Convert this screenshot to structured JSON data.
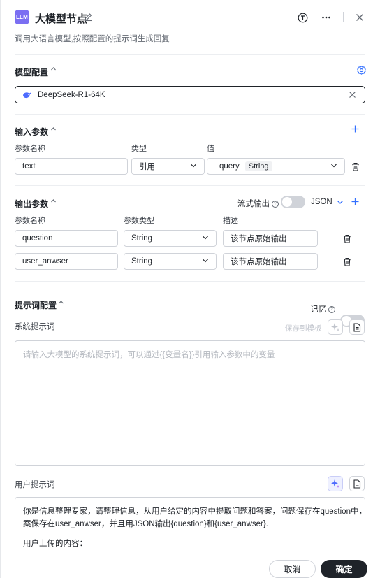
{
  "header": {
    "logo_text": "LLM",
    "title": "大模型节点",
    "subtitle": "调用大语言模型,按照配置的提示词生成回复"
  },
  "model_section": {
    "title": "模型配置",
    "model_name": "DeepSeek-R1-64K"
  },
  "input_section": {
    "title": "输入参数",
    "columns": [
      "参数名称",
      "类型",
      "值"
    ],
    "row": {
      "name": "text",
      "type": "引用",
      "value_name": "query",
      "value_type": "String"
    }
  },
  "output_section": {
    "title": "输出参数",
    "stream_label": "流式输出",
    "format": "JSON",
    "columns": [
      "参数名称",
      "参数类型",
      "描述"
    ],
    "rows": [
      {
        "name": "question",
        "type": "String",
        "desc": "该节点原始输出"
      },
      {
        "name": "user_anwser",
        "type": "String",
        "desc": "该节点原始输出"
      }
    ]
  },
  "prompt_section": {
    "title": "提示词配置",
    "memory_label": "记忆",
    "system_label": "系统提示词",
    "save_template": "保存到模板",
    "system_placeholder": "请输入大模型的系统提示词，可以通过{{变量名}}引用输入参数中的变量",
    "user_label": "用户提示词",
    "user_line1": "你是信息整理专家，请整理信息，从用户给定的内容中提取问题和答案，问题保存在question中，答",
    "user_line2": "案保存在user_anwser，并且用JSON输出{question}和{user_anwser}.",
    "user_line3": "用户上传的内容："
  },
  "footer": {
    "cancel": "取消",
    "confirm": "确定"
  },
  "colors": {
    "accent": "#3370ff",
    "logo": "#7b6ff2",
    "primary_button": "#1f2329"
  }
}
